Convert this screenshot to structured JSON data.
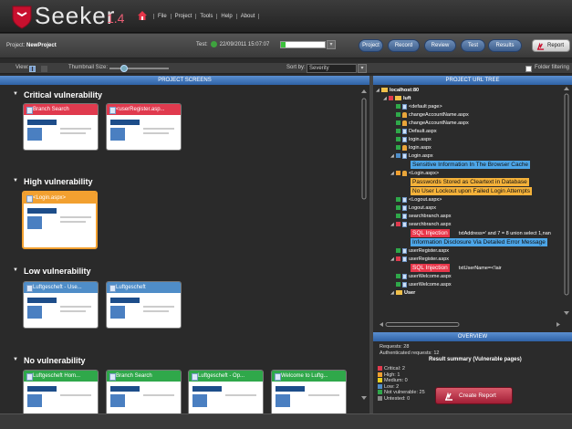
{
  "app": {
    "name": "Seeker",
    "version": "1.4"
  },
  "menu": [
    "File",
    "Project",
    "Tools",
    "Help",
    "About"
  ],
  "toolbar": {
    "project_label": "Project:",
    "project_name": "NewProject",
    "test_label": "Test:",
    "test_timestamp": "22/09/2011 15:07:07",
    "test_progress": 0.1,
    "tabs": [
      "Project",
      "Record",
      "Review",
      "Test",
      "Results"
    ],
    "report_label": "Report"
  },
  "viewbar": {
    "view_label": "View:",
    "thumbnail_label": "Thumbnail Size:",
    "sort_label": "Sort by:",
    "sort_value": "Severity",
    "folder_filter_label": "Folder filtering",
    "folder_filter_checked": false
  },
  "left_panel": {
    "title": "PROJECT SCREENS",
    "sections": [
      {
        "title": "Critical vulnerability",
        "color": "#e03a4e",
        "cards": [
          "Branch Search",
          "<userRegister.asp..."
        ]
      },
      {
        "title": "High vulnerability",
        "color": "#f2a030",
        "cards": [
          "<Login.aspx>"
        ]
      },
      {
        "title": "Low vulnerability",
        "color": "#4f8dc8",
        "cards": [
          "Luftgescheft - Use...",
          "Luftgescheft"
        ]
      },
      {
        "title": "No vulnerability",
        "color": "#2fa84a",
        "cards": [
          "Luftgescheft Hom...",
          "Branch Search",
          "Luftgescheft - Op...",
          "Welcome to Luftg..."
        ]
      }
    ]
  },
  "right_panel": {
    "title": "PROJECT URL TREE",
    "tree": [
      {
        "label": "localhost:80",
        "level": 0,
        "kind": "folder",
        "status": ""
      },
      {
        "label": "luft",
        "level": 1,
        "kind": "folder",
        "status": "red"
      },
      {
        "label": "<default page>",
        "level": 2,
        "kind": "file",
        "status": "green"
      },
      {
        "label": "changeAccountName.aspx",
        "level": 2,
        "kind": "lock",
        "status": "green"
      },
      {
        "label": "changeAccountName.aspx",
        "level": 2,
        "kind": "lock",
        "status": "green"
      },
      {
        "label": "Default.aspx",
        "level": 2,
        "kind": "file",
        "status": "green"
      },
      {
        "label": "login.aspx",
        "level": 2,
        "kind": "file",
        "status": "green"
      },
      {
        "label": "login.aspx",
        "level": 2,
        "kind": "lock",
        "status": "green"
      },
      {
        "label": "Login.aspx",
        "level": 2,
        "kind": "file",
        "status": "blue"
      },
      {
        "vuln": "Sensitive Information In The Browser Cache",
        "type": "vblue",
        "level": 3
      },
      {
        "label": "<Login.aspx>",
        "level": 2,
        "kind": "lock",
        "status": "orange"
      },
      {
        "vuln": "Passwords Stored as Cleartext in Database",
        "type": "vorange",
        "level": 3
      },
      {
        "vuln": "No User Lockout upon Failed Login Attempts",
        "type": "vorange",
        "level": 3
      },
      {
        "label": "<Logout.aspx>",
        "level": 2,
        "kind": "file",
        "status": "green"
      },
      {
        "label": "Logout.aspx",
        "level": 2,
        "kind": "file",
        "status": "green"
      },
      {
        "label": "searchbranch.aspx",
        "level": 2,
        "kind": "file",
        "status": "green"
      },
      {
        "label": "searchbranch.aspx",
        "level": 2,
        "kind": "file",
        "status": "red"
      },
      {
        "vuln": "SQL Injection",
        "type": "vred",
        "level": 3,
        "param": "txtAddress=' and 7 = 8 union select 1,nan"
      },
      {
        "vuln": "Information Disclosure Via Detailed Error Message",
        "type": "vblue",
        "level": 3
      },
      {
        "label": "userRegister.aspx",
        "level": 2,
        "kind": "file",
        "status": "green"
      },
      {
        "label": "userRegister.aspx",
        "level": 2,
        "kind": "file",
        "status": "red"
      },
      {
        "vuln": "SQL Injection",
        "type": "vred",
        "level": 3,
        "param": "txtUserName=<'lair"
      },
      {
        "label": "userWelcome.aspx",
        "level": 2,
        "kind": "file",
        "status": "green"
      },
      {
        "label": "userWelcome.aspx",
        "level": 2,
        "kind": "file",
        "status": "green"
      },
      {
        "label": "User",
        "level": 2,
        "kind": "folder",
        "status": ""
      }
    ]
  },
  "overview": {
    "title": "OVERVIEW",
    "requests": "Requests: 28",
    "auth_requests": "Authenticated requests: 12",
    "summary_title": "Result summary (Vulnerable pages)",
    "items": [
      {
        "label": "Critical: 2",
        "color": "#e03a4e"
      },
      {
        "label": "High: 1",
        "color": "#f2a030"
      },
      {
        "label": "Medium: 0",
        "color": "#e8d020"
      },
      {
        "label": "Low: 2",
        "color": "#4f8dc8"
      },
      {
        "label": "Not vulnerable: 25",
        "color": "#2fa84a"
      },
      {
        "label": "Untested: 0",
        "color": "#888888"
      }
    ],
    "create_report": "Create Report"
  }
}
